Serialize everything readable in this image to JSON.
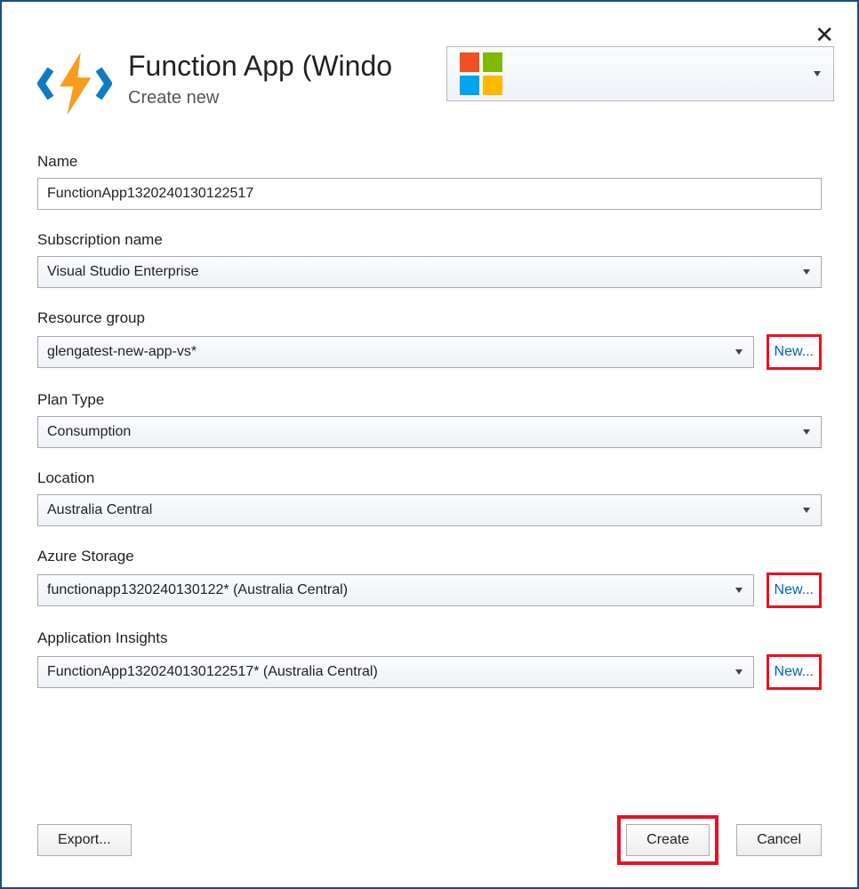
{
  "header": {
    "title": "Function App (Windo",
    "subtitle": "Create new",
    "close_label": "✕"
  },
  "account": {
    "selected": ""
  },
  "form": {
    "name": {
      "label": "Name",
      "value": "FunctionApp1320240130122517"
    },
    "subscription": {
      "label": "Subscription name",
      "value": "Visual Studio Enterprise"
    },
    "resource_group": {
      "label": "Resource group",
      "value": "glengatest-new-app-vs*",
      "new_label": "New..."
    },
    "plan_type": {
      "label": "Plan Type",
      "value": "Consumption"
    },
    "location": {
      "label": "Location",
      "value": "Australia Central"
    },
    "storage": {
      "label": "Azure Storage",
      "value": "functionapp1320240130122* (Australia Central)",
      "new_label": "New..."
    },
    "insights": {
      "label": "Application Insights",
      "value": "FunctionApp1320240130122517* (Australia Central)",
      "new_label": "New..."
    }
  },
  "footer": {
    "export_label": "Export...",
    "create_label": "Create",
    "cancel_label": "Cancel"
  }
}
